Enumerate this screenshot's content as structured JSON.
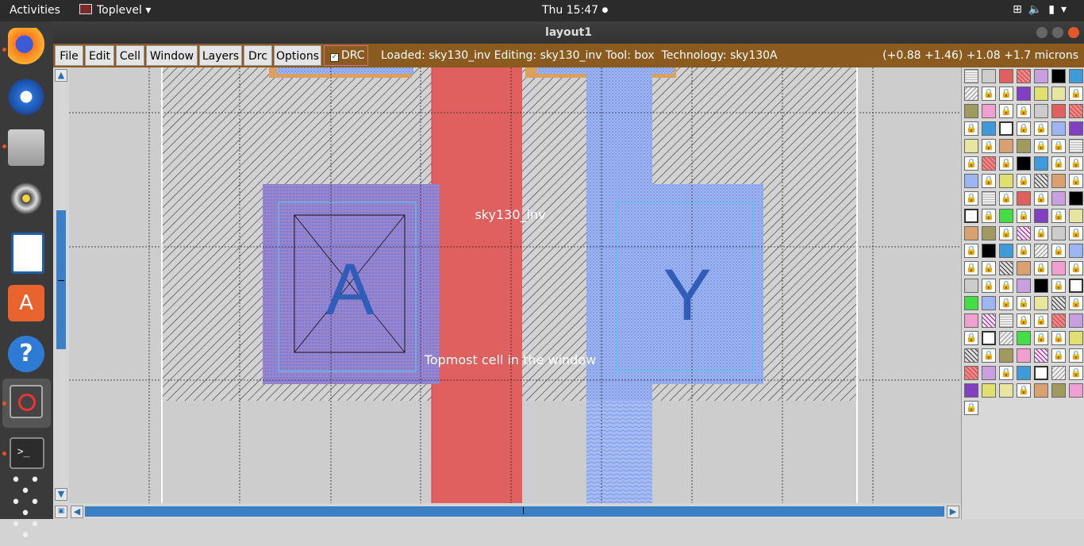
{
  "topbar": {
    "activities": "Activities",
    "app_name": "Toplevel",
    "app_arrow": "▾",
    "clock": "Thu 15:47",
    "clock_dot": "●",
    "tray_icons": [
      "network-icon",
      "volume-icon",
      "battery-icon",
      "power-menu-icon"
    ]
  },
  "dock": {
    "items": [
      "firefox",
      "thunderbird",
      "files",
      "rhythmbox",
      "writer",
      "software-center",
      "help",
      "magic-toplevel",
      "terminal",
      "show-apps"
    ]
  },
  "window": {
    "title": "layout1"
  },
  "menubar": {
    "file": "File",
    "edit": "Edit",
    "cell": "Cell",
    "window": "Window",
    "layers": "Layers",
    "drc": "Drc",
    "options": "Options",
    "drc_toggle": "DRC",
    "status": "Loaded: sky130_inv Editing: sky130_inv Tool: box  Technology: sky130A",
    "coords": "(+0.88 +1.46) +1.08 +1.7 microns"
  },
  "layout": {
    "cell_name": "sky130_inv",
    "label_a": "A",
    "label_y": "Y",
    "hint": "Topmost cell in the window"
  },
  "colors": {
    "menubar": "#8b5a1e",
    "poly": "#e06060",
    "li1": "#8fa8ef",
    "metal1": "#8c84d8",
    "label": "#2f5db8",
    "scroll": "#3b80c4"
  }
}
